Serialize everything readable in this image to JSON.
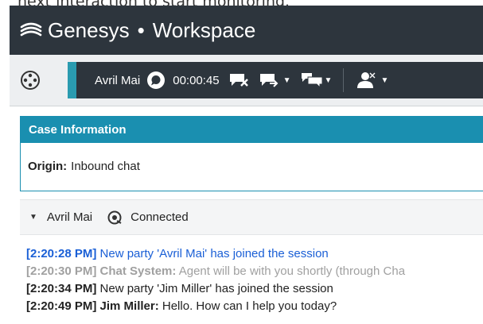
{
  "caption": "next interaction to start monitoring.",
  "header": {
    "brand": "Genesys",
    "separator": "•",
    "product": "Workspace"
  },
  "interaction": {
    "party_name": "Avril Mai",
    "timer": "00:00:45"
  },
  "case": {
    "title": "Case Information",
    "origin_label": "Origin:",
    "origin_value": "Inbound chat"
  },
  "party": {
    "name": "Avril Mai",
    "state": "Connected"
  },
  "transcript": [
    {
      "time": "[2:20:28 PM]",
      "author": "",
      "text": " New party 'Avril Mai' has joined the session",
      "style": "blue"
    },
    {
      "time": "[2:20:30 PM]",
      "author": " Chat System:",
      "text": " Agent will be with you shortly (through Cha",
      "style": "grey"
    },
    {
      "time": "[2:20:34 PM]",
      "author": "",
      "text": " New party 'Jim Miller' has joined the session",
      "style": "dark"
    },
    {
      "time": "[2:20:49 PM]",
      "author": " Jim Miller:",
      "text": " Hello. How can I help you today?",
      "style": "dark"
    }
  ],
  "colors": {
    "titlebar": "#2d353d",
    "accent": "#2a9bb0",
    "case_header": "#1a8fb0",
    "system_message": "#1a5fd6"
  },
  "icons": {
    "logo": "genesys-logo-icon",
    "vendor": "vendor-menu-icon",
    "chat_status": "chat-bubble-icon",
    "end_chat": "end-chat-icon",
    "transfer": "transfer-chat-icon",
    "conference": "conference-chat-icon",
    "party_action": "party-action-icon",
    "connected": "at-sign-icon"
  }
}
